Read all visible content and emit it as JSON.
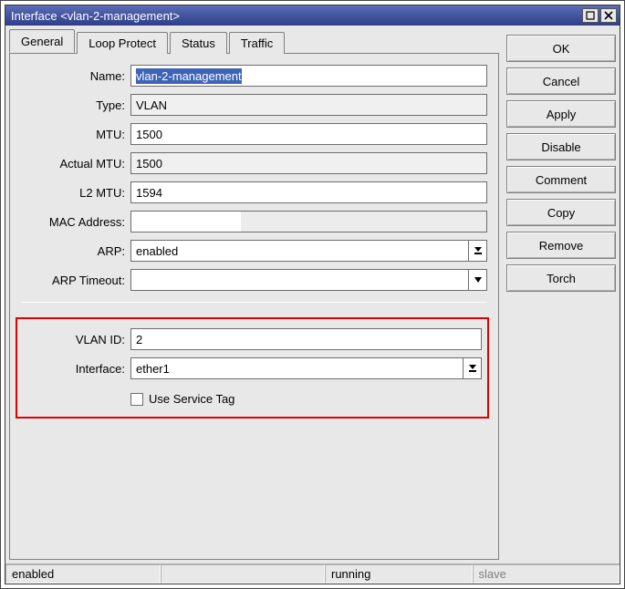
{
  "window_title": "Interface <vlan-2-management>",
  "tabs": [
    "General",
    "Loop Protect",
    "Status",
    "Traffic"
  ],
  "active_tab": 0,
  "form": {
    "name_label": "Name:",
    "name_value": "vlan-2-management",
    "type_label": "Type:",
    "type_value": "VLAN",
    "mtu_label": "MTU:",
    "mtu_value": "1500",
    "actual_mtu_label": "Actual MTU:",
    "actual_mtu_value": "1500",
    "l2mtu_label": "L2 MTU:",
    "l2mtu_value": "1594",
    "mac_label": "MAC Address:",
    "mac_value": "",
    "arp_label": "ARP:",
    "arp_value": "enabled",
    "arp_timeout_label": "ARP Timeout:",
    "arp_timeout_value": "",
    "vlan_id_label": "VLAN ID:",
    "vlan_id_value": "2",
    "interface_label": "Interface:",
    "interface_value": "ether1",
    "use_service_tag_label": "Use Service Tag",
    "use_service_tag_checked": false
  },
  "buttons": {
    "ok": "OK",
    "cancel": "Cancel",
    "apply": "Apply",
    "disable": "Disable",
    "comment": "Comment",
    "copy": "Copy",
    "remove": "Remove",
    "torch": "Torch"
  },
  "statusbar": {
    "enabled": "enabled",
    "running": "running",
    "slave": "slave"
  },
  "icons": {
    "minimize": "minimize-icon",
    "close": "close-icon",
    "dropdown": "dropdown-icon"
  }
}
